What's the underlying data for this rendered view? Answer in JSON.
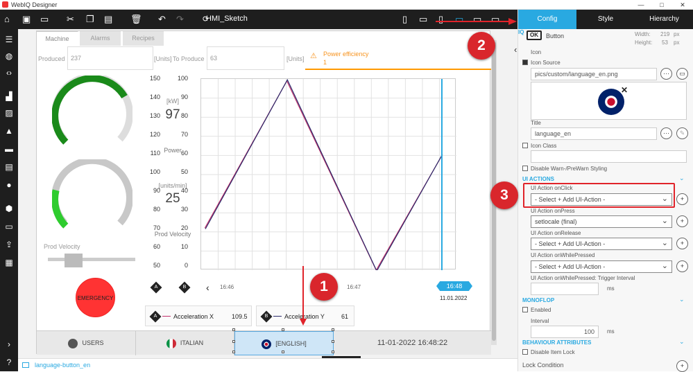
{
  "app": {
    "title": "WebIQ Designer",
    "file_title": "HMI_Sketch",
    "win_min": "—",
    "win_max": "□",
    "win_close": "✕"
  },
  "hmi": {
    "tabs": [
      "Machine",
      "Alarms",
      "Recipes"
    ],
    "produced_label": "Produced",
    "produced_value": "237",
    "produced_unit": "[Units]",
    "to_produce_label": "To Produce",
    "to_produce_value": "63",
    "to_produce_unit": "[Units]",
    "power_eff_label": "Power efficiency",
    "power_eff_value": "1",
    "power_gauge": {
      "unit": "[kW]",
      "value": "97",
      "caption": "Power",
      "level": 0.72,
      "color": "#1a8a1a"
    },
    "velocity_gauge": {
      "unit": "[units/min]",
      "value": "25",
      "caption": "Prod Velocity",
      "level": 0.22,
      "color": "#2ecc2e"
    },
    "slider_label": "Prod Velocity",
    "emergency_label": "EMERGENCY",
    "axis_a_ticks": [
      "150",
      "140",
      "130",
      "120",
      "110",
      "100",
      "90",
      "80",
      "70",
      "60",
      "50"
    ],
    "axis_b_ticks": [
      "100",
      "90",
      "80",
      "70",
      "60",
      "50",
      "40",
      "30",
      "20",
      "10",
      "0"
    ],
    "axis_a_marker": "A",
    "axis_b_marker": "B",
    "time_start": "16:46",
    "time_mid": "16:47",
    "cursor_time": "16:48",
    "cursor_date": "11.01.2022",
    "legend": [
      {
        "marker": "A",
        "name": "Acceleration X",
        "value": "109.5",
        "color": "#c0306a"
      },
      {
        "marker": "B",
        "name": "Acceleration Y",
        "value": "61",
        "color": "#2b2b6b"
      }
    ],
    "bottom": {
      "users": "USERS",
      "italian": "ITALIAN",
      "english": "[ENGLISH]",
      "datetime": "11-01-2022 16:48:22"
    }
  },
  "tooltip": "language_en",
  "status": {
    "element_name": "language-button_en"
  },
  "panel": {
    "tabs": [
      "Config",
      "Style",
      "Hierarchy"
    ],
    "widget_type": "Button",
    "widget_badge": "OK",
    "width_label": "Width:",
    "width_value": "219",
    "height_label": "Height:",
    "height_value": "53",
    "unit": "px",
    "icon_label": "Icon",
    "icon_source_label": "Icon Source",
    "icon_source_value": "pics/custom/language_en.png",
    "title_label": "Title",
    "title_value": "language_en",
    "icon_class_label": "Icon Class",
    "disable_warn_label": "Disable Warn-/PreWarn Styling",
    "ui_actions_title": "UI ACTIONS",
    "onclick_label": "UI Action onClick",
    "onclick_value": "- Select + Add UI-Action -",
    "onpress_label": "UI Action onPress",
    "onpress_value": "setlocale (final)",
    "onrelease_label": "UI Action onRelease",
    "onrelease_value": "- Select + Add UI-Action -",
    "onwhile_label": "UI Action onWhilePressed",
    "onwhile_value": "- Select + Add UI-Action -",
    "trigger_label": "UI Action onWhilePressed: Trigger Interval",
    "ms": "ms",
    "monoflop_title": "MONOFLOP",
    "enabled_label": "Enabled",
    "interval_label": "Interval",
    "interval_value": "100",
    "behaviour_title": "BEHAVIOUR ATTRIBUTES",
    "disable_lock_label": "Disable Item Lock",
    "lock_condition_label": "Lock Condition"
  },
  "callouts": [
    "1",
    "2",
    "3"
  ],
  "chart_data": {
    "type": "line",
    "x": [
      "16:45:50",
      "16:46:35",
      "16:47:24",
      "16:48:00"
    ],
    "series": [
      {
        "name": "Acceleration X",
        "axis": "A",
        "values": [
          72,
          149,
          50,
          110
        ]
      },
      {
        "name": "Acceleration Y",
        "axis": "B",
        "values": [
          22,
          100,
          0,
          61
        ]
      }
    ],
    "ylim_a": [
      50,
      150
    ],
    "ylim_b": [
      0,
      100
    ],
    "grid": true
  }
}
